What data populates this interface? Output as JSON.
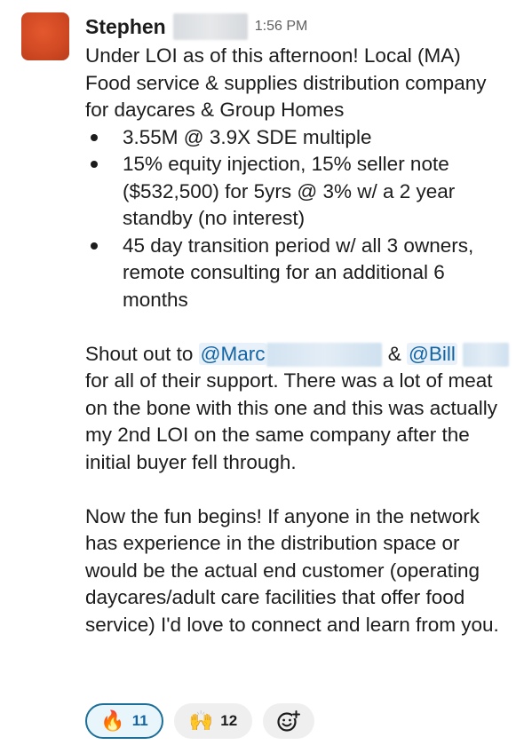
{
  "message": {
    "author": "Stephen",
    "timestamp": "1:56 PM",
    "intro": "Under LOI as of this afternoon! Local (MA) Food service & supplies distribution company for daycares & Group Homes",
    "bullets": [
      "3.55M @ 3.9X SDE multiple",
      "15% equity injection, 15% seller note ($532,500) for 5yrs @ 3% w/ a 2 year standby (no interest)",
      "45 day transition period w/ all 3 owners, remote consulting for an additional 6 months"
    ],
    "shoutout": {
      "prefix": "Shout out to",
      "mention1": "@Marc",
      "ampersand": "&",
      "mention2": "@Bill",
      "rest": "for all of their support. There was a lot of meat on the bone with this one and this was actually my 2nd LOI on the same company after the initial buyer fell through."
    },
    "closing": "Now the fun begins! If anyone in the network has experience in the distribution space or would be the actual end customer (operating daycares/adult care facilities that offer food service) I'd love to connect and learn from you."
  },
  "reactions": [
    {
      "emoji": "🔥",
      "icon": "fire-emoji",
      "count": "11",
      "active": true
    },
    {
      "emoji": "🙌",
      "icon": "raised-hands-emoji",
      "count": "12",
      "active": false
    }
  ],
  "add_reaction_icon": "add-reaction-icon",
  "colors": {
    "avatar": "#d14a23",
    "mention_text": "#1264a3",
    "mention_bg": "#e8f1fa",
    "active_reaction_border": "#1d6f99"
  }
}
